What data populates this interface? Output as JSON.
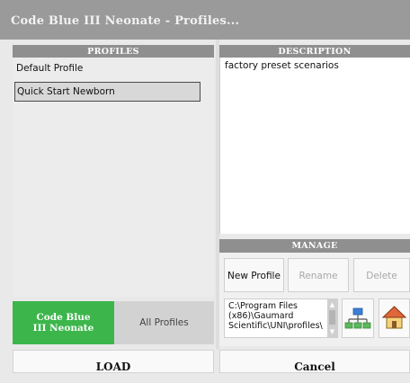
{
  "window": {
    "title": "Code Blue III Neonate - Profiles..."
  },
  "profiles": {
    "header": "PROFILES",
    "items": [
      "Default Profile",
      "Quick Start Newborn"
    ],
    "selected": "Quick Start Newborn"
  },
  "description": {
    "header": "DESCRIPTION",
    "text": "factory preset scenarios"
  },
  "manage": {
    "header": "MANAGE",
    "new_profile": "New Profile",
    "rename": "Rename",
    "delete": "Delete",
    "path": "C:\\Program Files (x86)\\Gaumard Scientific\\UNI\\profiles\\",
    "icons": [
      "network-folder-icon",
      "home-icon"
    ]
  },
  "filter_tabs": {
    "active": "Code Blue III Neonate",
    "other": "All Profiles",
    "active_color": "#3cb64b"
  },
  "footer": {
    "load": "LOAD",
    "cancel": "Cancel"
  }
}
